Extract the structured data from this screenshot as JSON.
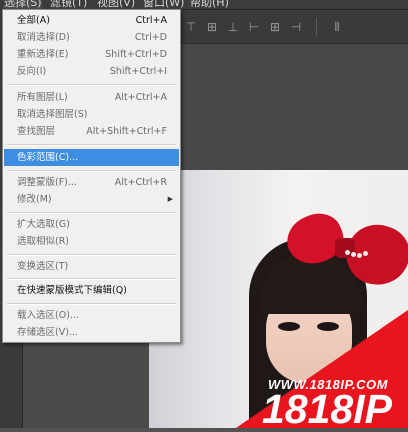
{
  "menubar": {
    "items": [
      "选择(S)",
      "滤镜(T)",
      "视图(V)",
      "窗口(W)",
      "帮助(H)"
    ]
  },
  "select_menu": {
    "groups": [
      [
        {
          "label": "全部(A)",
          "shortcut": "Ctrl+A",
          "enabled": true
        },
        {
          "label": "取消选择(D)",
          "shortcut": "Ctrl+D",
          "enabled": false
        },
        {
          "label": "重新选择(E)",
          "shortcut": "Shift+Ctrl+D",
          "enabled": false
        },
        {
          "label": "反向(I)",
          "shortcut": "Shift+Ctrl+I",
          "enabled": false
        }
      ],
      [
        {
          "label": "所有图层(L)",
          "shortcut": "Alt+Ctrl+A",
          "enabled": false
        },
        {
          "label": "取消选择图层(S)",
          "shortcut": "",
          "enabled": false
        },
        {
          "label": "查找图层",
          "shortcut": "Alt+Shift+Ctrl+F",
          "enabled": false
        }
      ],
      [
        {
          "label": "色彩范围(C)...",
          "shortcut": "",
          "enabled": true,
          "highlighted": true
        }
      ],
      [
        {
          "label": "调整蒙版(F)...",
          "shortcut": "Alt+Ctrl+R",
          "enabled": false
        },
        {
          "label": "修改(M)",
          "shortcut": "",
          "enabled": false,
          "submenu": true
        }
      ],
      [
        {
          "label": "扩大选取(G)",
          "shortcut": "",
          "enabled": false
        },
        {
          "label": "选取相似(R)",
          "shortcut": "",
          "enabled": false
        }
      ],
      [
        {
          "label": "变换选区(T)",
          "shortcut": "",
          "enabled": false
        }
      ],
      [
        {
          "label": "在快速蒙版模式下编辑(Q)",
          "shortcut": "",
          "enabled": true
        }
      ],
      [
        {
          "label": "载入选区(O)...",
          "shortcut": "",
          "enabled": false
        },
        {
          "label": "存储选区(V)...",
          "shortcut": "",
          "enabled": false
        }
      ]
    ]
  },
  "watermark": {
    "url": "WWW.1818IP.COM",
    "brand": "1818IP"
  },
  "colors": {
    "menu_highlight": "#3d8ee3",
    "watermark_red": "#e8141e"
  }
}
